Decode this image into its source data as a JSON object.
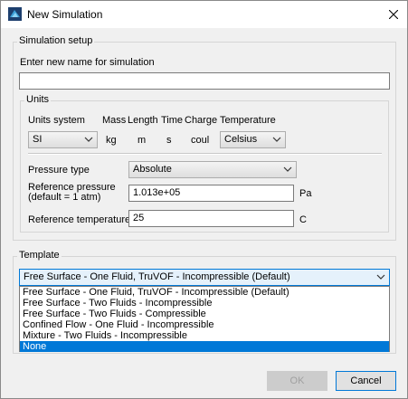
{
  "window": {
    "title": "New Simulation"
  },
  "setup": {
    "legend": "Simulation setup",
    "name_label": "Enter new name for simulation",
    "name_value": ""
  },
  "units": {
    "legend": "Units",
    "headers": {
      "system": "Units system",
      "mass": "Mass",
      "length": "Length",
      "time": "Time",
      "charge": "Charge",
      "temperature": "Temperature"
    },
    "system_value": "SI",
    "mass": "kg",
    "length": "m",
    "time": "s",
    "charge": "coul",
    "temperature_value": "Celsius"
  },
  "pressure": {
    "type_label": "Pressure type",
    "type_value": "Absolute",
    "ref_label_line1": "Reference pressure",
    "ref_label_line2": "(default = 1 atm)",
    "ref_value": "1.013e+05",
    "ref_unit": "Pa"
  },
  "temperature": {
    "ref_label": "Reference temperature",
    "ref_value": "25",
    "ref_unit": "C"
  },
  "template": {
    "legend": "Template",
    "selected": "Free Surface - One Fluid, TruVOF - Incompressible (Default)",
    "options": [
      "Free Surface - One Fluid, TruVOF - Incompressible (Default)",
      "Free Surface - Two Fluids - Incompressible",
      "Free Surface - Two Fluids - Compressible",
      "Confined Flow - One Fluid - Incompressible",
      "Mixture - Two Fluids - Incompressible",
      "None"
    ],
    "highlighted_index": 5
  },
  "buttons": {
    "ok": "OK",
    "cancel": "Cancel"
  },
  "colors": {
    "highlight": "#0078d7",
    "combo_focus_border": "#0078d7"
  },
  "icons": {
    "app": "flow3d-app-icon",
    "close": "close-icon",
    "dropdown": "chevron-down-icon"
  }
}
